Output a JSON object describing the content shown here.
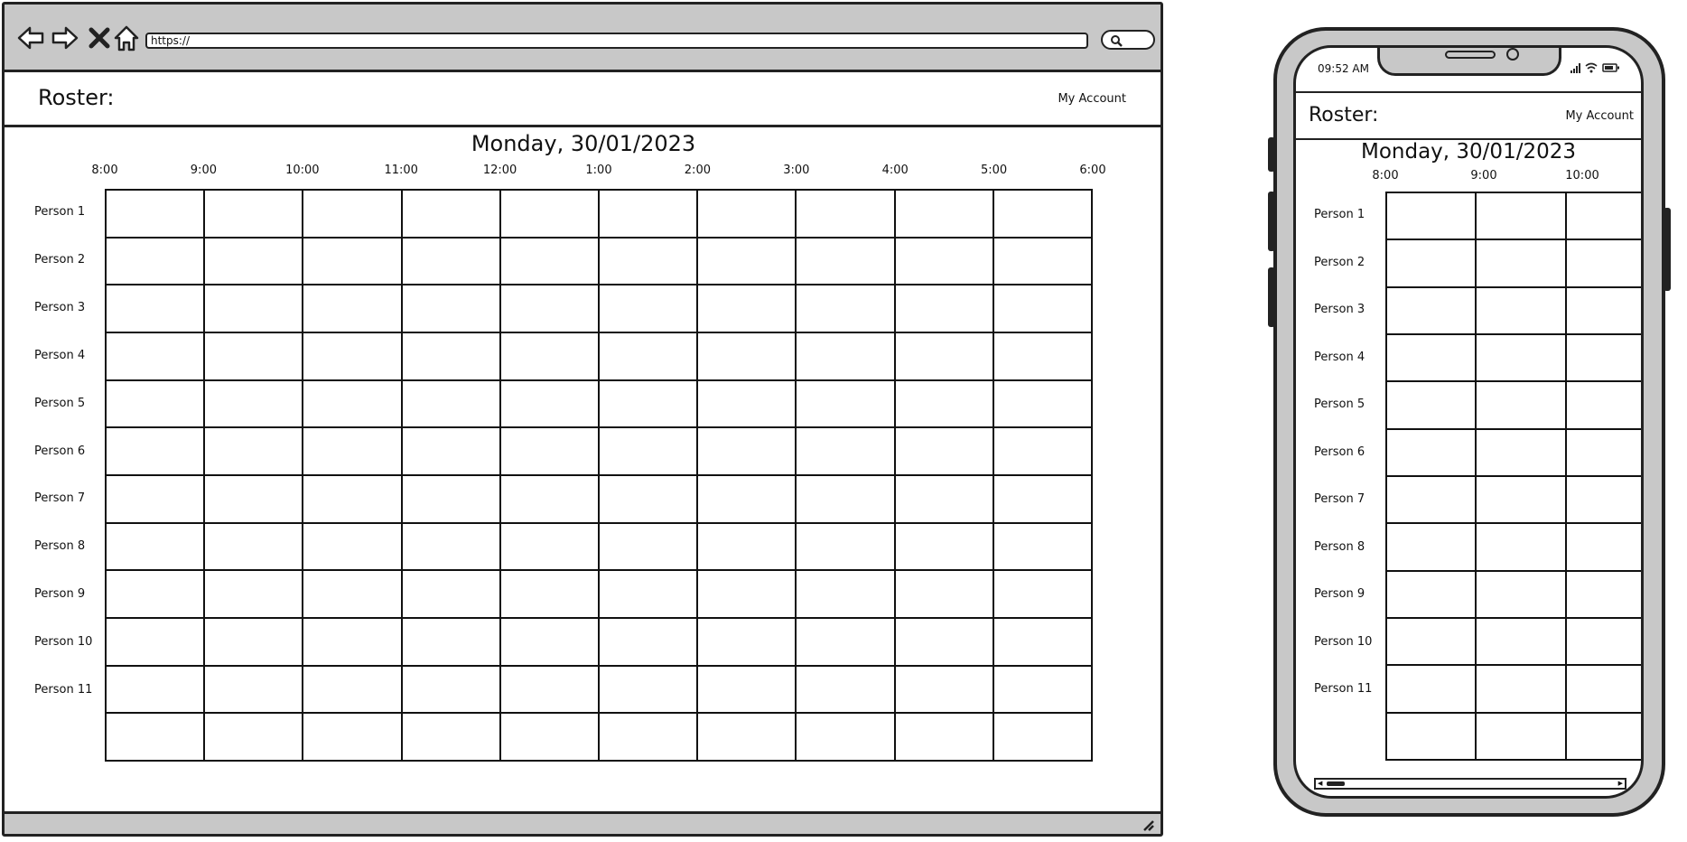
{
  "browser": {
    "url": "https://",
    "title": "Roster:",
    "account_label": "My Account",
    "date": "Monday, 30/01/2023",
    "times": [
      "8:00",
      "9:00",
      "10:00",
      "11:00",
      "12:00",
      "1:00",
      "2:00",
      "3:00",
      "4:00",
      "5:00",
      "6:00"
    ],
    "people": [
      "Person 1",
      "Person 2",
      "Person 3",
      "Person 4",
      "Person 5",
      "Person 6",
      "Person 7",
      "Person 8",
      "Person 9",
      "Person 10",
      "Person 11"
    ],
    "grid": {
      "rows": 12,
      "cols": 10
    },
    "icons": [
      "back-arrow-icon",
      "forward-arrow-icon",
      "close-x-icon",
      "home-icon",
      "search-icon",
      "resize-grip-icon"
    ]
  },
  "phone": {
    "clock": "09:52 AM",
    "title": "Roster:",
    "account_label": "My Account",
    "date": "Monday, 30/01/2023",
    "times": [
      "8:00",
      "9:00",
      "10:00"
    ],
    "people": [
      "Person 1",
      "Person 2",
      "Person 3",
      "Person 4",
      "Person 5",
      "Person 6",
      "Person 7",
      "Person 8",
      "Person 9",
      "Person 10",
      "Person 11"
    ],
    "grid": {
      "rows": 12,
      "cols": 3
    },
    "icons": [
      "signal-icon",
      "wifi-icon",
      "battery-icon",
      "scroll-left-icon",
      "scroll-right-icon"
    ]
  },
  "colors": {
    "chrome": "#c8c8c8",
    "ink": "#222222",
    "paper": "#ffffff"
  }
}
